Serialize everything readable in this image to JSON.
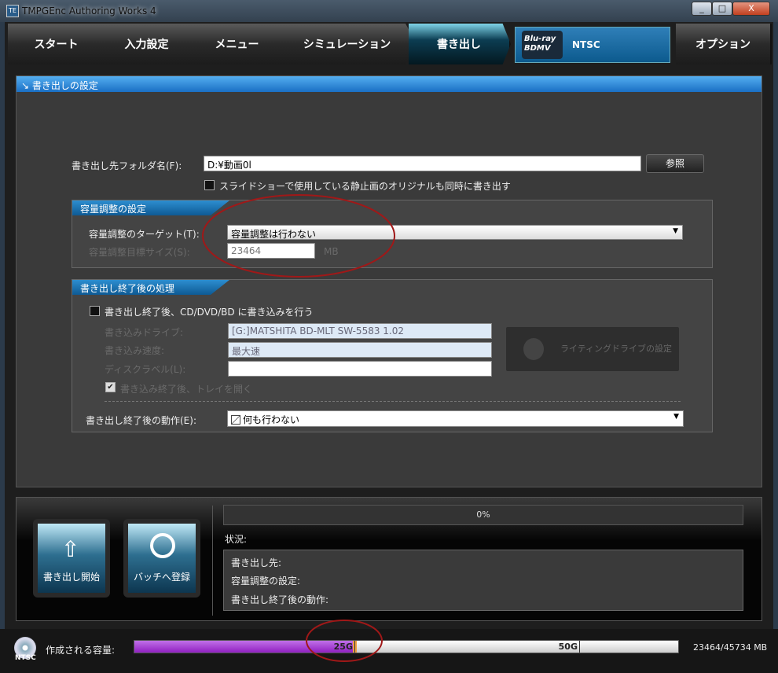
{
  "window": {
    "title": "TMPGEnc Authoring Works 4",
    "minimize": "_",
    "maximize": "□",
    "close": "X"
  },
  "tabs": [
    {
      "label": "スタート"
    },
    {
      "label": "入力設定"
    },
    {
      "label": "メニュー"
    },
    {
      "label": "シミュレーション"
    },
    {
      "label": "書き出し",
      "active": true
    },
    {
      "label": "オプション"
    }
  ],
  "format": {
    "logo": "Blu-ray BDMV",
    "standard": "NTSC"
  },
  "panel": {
    "title": "書き出しの設定",
    "folder_label": "書き出し先フォルダ名(F):",
    "folder_value": "D:¥動画0l",
    "browse": "参照",
    "slideshow_checkbox": "スライドショーで使用している静止画のオリジナルも同時に書き出す",
    "capacity": {
      "title": "容量調整の設定",
      "target_label": "容量調整のターゲット(T):",
      "target_value": "容量調整は行わない",
      "size_label": "容量調整目標サイズ(S):",
      "size_value": "23464",
      "unit": "MB"
    },
    "post": {
      "title": "書き出し終了後の処理",
      "write_checkbox": "書き出し終了後、CD/DVD/BD に書き込みを行う",
      "drive_label": "書き込みドライブ:",
      "drive_value": "[G:]MATSHITA BD-MLT SW-5583 1.02",
      "speed_label": "書き込み速度:",
      "speed_value": "最大速",
      "disc_label": "ディスクラベル(L):",
      "disc_value": "",
      "tray_checkbox": "書き込み終了後、トレイを開く",
      "drive_settings": "ライティングドライブの設定",
      "action_label": "書き出し終了後の動作(E):",
      "action_value": "何も行わない"
    }
  },
  "bottom": {
    "start": "書き出し開始",
    "batch": "バッチへ登録",
    "progress": "0%",
    "progress_value": 0,
    "status_label": "状況:",
    "info": [
      "書き出し先:",
      "容量調整の設定:",
      "書き出し終了後の動作:"
    ]
  },
  "statusbar": {
    "disc": "NTSC",
    "capacity_label": "作成される容量:",
    "mark1": "25G",
    "mark2": "50G",
    "usage": "23464/45734 MB",
    "fill_fraction": 0.513,
    "colors": {
      "fill": "#a040d0",
      "marker": "#f0a040"
    }
  }
}
